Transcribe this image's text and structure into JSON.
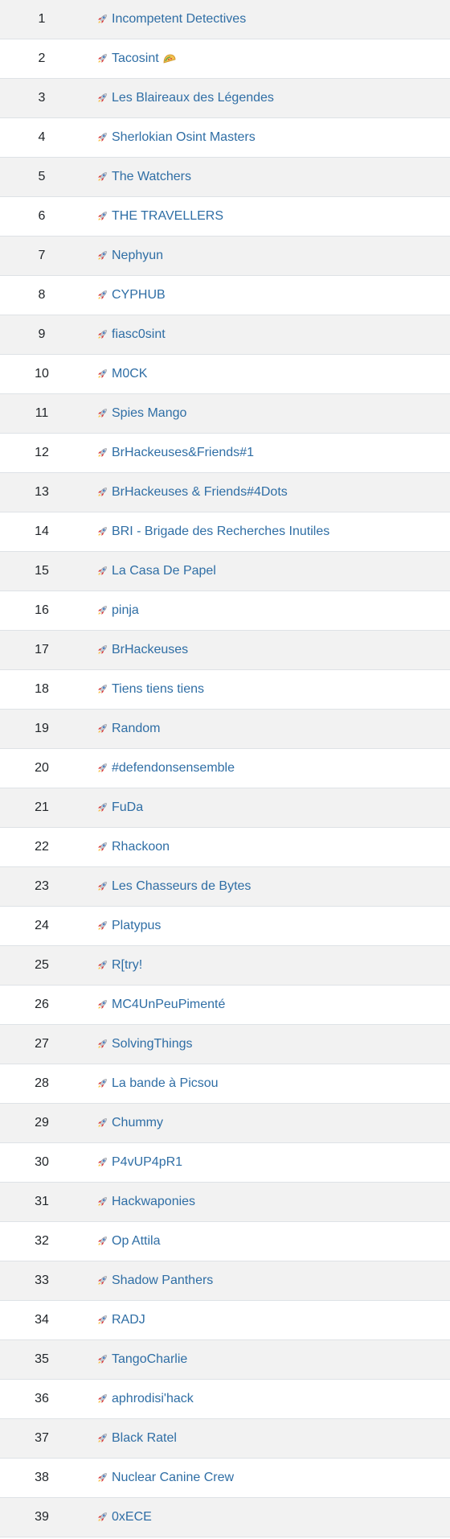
{
  "scoreboard": {
    "rows": [
      {
        "rank": "1",
        "team": "Incompetent Detectives"
      },
      {
        "rank": "2",
        "team": "Tacosint",
        "emoji": "taco-icon"
      },
      {
        "rank": "3",
        "team": "Les Blaireaux des Légendes"
      },
      {
        "rank": "4",
        "team": "Sherlokian Osint Masters"
      },
      {
        "rank": "5",
        "team": "The Watchers"
      },
      {
        "rank": "6",
        "team": "THE TRAVELLERS"
      },
      {
        "rank": "7",
        "team": "Nephyun"
      },
      {
        "rank": "8",
        "team": "CYPHUB"
      },
      {
        "rank": "9",
        "team": "fiasc0sint"
      },
      {
        "rank": "10",
        "team": "M0CK"
      },
      {
        "rank": "11",
        "team": "Spies Mango"
      },
      {
        "rank": "12",
        "team": "BrHackeuses&Friends#1"
      },
      {
        "rank": "13",
        "team": "BrHackeuses & Friends#4Dots"
      },
      {
        "rank": "14",
        "team": "BRI - Brigade des Recherches Inutiles"
      },
      {
        "rank": "15",
        "team": "La Casa De Papel"
      },
      {
        "rank": "16",
        "team": "pinja"
      },
      {
        "rank": "17",
        "team": "BrHackeuses"
      },
      {
        "rank": "18",
        "team": "Tiens tiens tiens"
      },
      {
        "rank": "19",
        "team": "Random"
      },
      {
        "rank": "20",
        "team": "#defendonsensemble"
      },
      {
        "rank": "21",
        "team": "FuDa"
      },
      {
        "rank": "22",
        "team": "Rhackoon"
      },
      {
        "rank": "23",
        "team": "Les Chasseurs de Bytes"
      },
      {
        "rank": "24",
        "team": "Platypus"
      },
      {
        "rank": "25",
        "team": "R[try!"
      },
      {
        "rank": "26",
        "team": "MC4UnPeuPimenté"
      },
      {
        "rank": "27",
        "team": "SolvingThings"
      },
      {
        "rank": "28",
        "team": "La bande à Picsou"
      },
      {
        "rank": "29",
        "team": "Chummy"
      },
      {
        "rank": "30",
        "team": "P4vUP4pR1"
      },
      {
        "rank": "31",
        "team": "Hackwaponies"
      },
      {
        "rank": "32",
        "team": "Op Attila"
      },
      {
        "rank": "33",
        "team": "Shadow Panthers"
      },
      {
        "rank": "34",
        "team": "RADJ"
      },
      {
        "rank": "35",
        "team": "TangoCharlie"
      },
      {
        "rank": "36",
        "team": "aphrodisi'hack"
      },
      {
        "rank": "37",
        "team": "Black Ratel"
      },
      {
        "rank": "38",
        "team": "Nuclear Canine Crew"
      },
      {
        "rank": "39",
        "team": "0xECE"
      }
    ],
    "team_icon": "rocket-icon"
  },
  "colors": {
    "link": "#2f6ea5",
    "stripe": "#f2f2f2",
    "border": "#dee2e6",
    "rank_text": "#212529"
  }
}
